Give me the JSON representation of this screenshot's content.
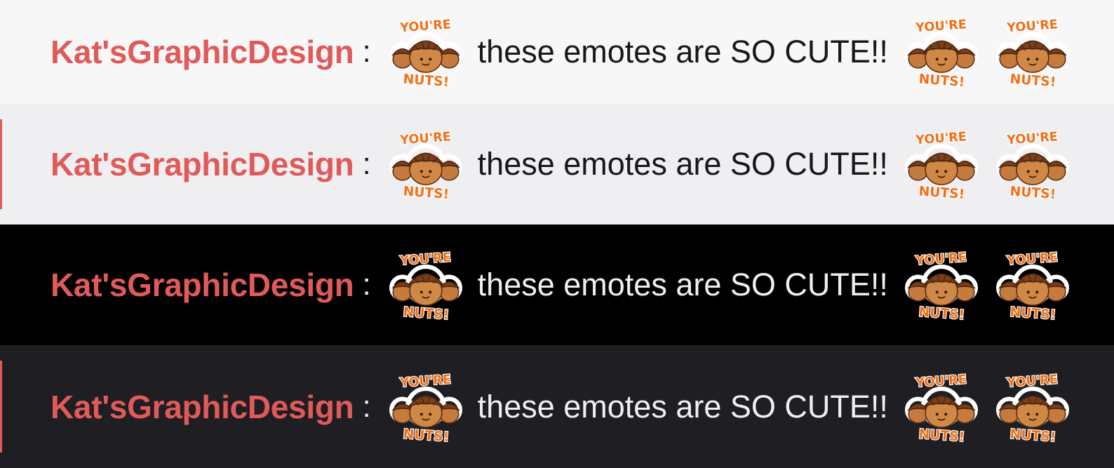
{
  "colors": {
    "username": "#e05a5a",
    "text_light_theme": "#18181b",
    "text_dark_theme": "#efeff1",
    "highlight_bar": "#e05a5a",
    "row_light": "#f7f7f8",
    "row_light_alt": "#efeff1",
    "row_dark": "#000000",
    "row_dark_alt": "#1f1f23"
  },
  "emote": {
    "icon": "youre-nuts-acorn-emote",
    "top_text": "YOU'RE",
    "bottom_text": "NUTS!"
  },
  "rows": [
    {
      "theme": "light",
      "username": "Kat'sGraphicDesign",
      "separator": ":",
      "message": "these emotes are SO CUTE!!"
    },
    {
      "theme": "light-alt",
      "username": "Kat'sGraphicDesign",
      "separator": ":",
      "message": "these emotes are SO CUTE!!"
    },
    {
      "theme": "dark",
      "username": "Kat'sGraphicDesign",
      "separator": ":",
      "message": "these emotes are SO CUTE!!"
    },
    {
      "theme": "dark-alt",
      "username": "Kat'sGraphicDesign",
      "separator": ":",
      "message": "these emotes are SO CUTE!!"
    }
  ]
}
